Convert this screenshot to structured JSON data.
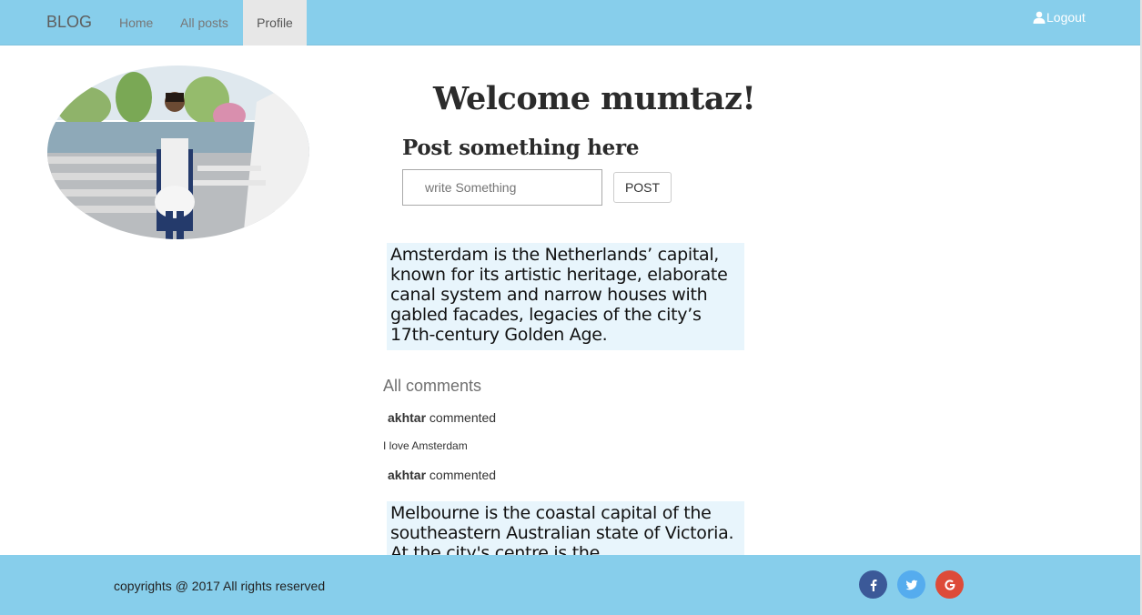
{
  "navbar": {
    "brand": "BLOG",
    "items": [
      {
        "label": "Home"
      },
      {
        "label": "All posts"
      },
      {
        "label": "Profile",
        "active": true
      }
    ],
    "logout_label": "Logout",
    "logout_icon": "user-icon",
    "bg_color": "#87CEEB"
  },
  "main": {
    "welcome": "Welcome mumtaz!",
    "post_heading": "Post something here",
    "post_input": {
      "placeholder": "write Something",
      "value": ""
    },
    "post_button": "POST",
    "posts": [
      {
        "text": "Amsterdam is the Netherlands’ capital, known for its artistic heritage, elaborate canal system and narrow houses with gabled facades, legacies of the city’s 17th-century Golden Age."
      },
      {
        "text": "Melbourne is the coastal capital of the southeastern Australian state of Victoria. At the city's centre is the"
      }
    ],
    "comments_title": "All comments",
    "comments": [
      {
        "author": "akhtar",
        "action": "commented",
        "text": "I love Amsterdam"
      },
      {
        "author": "akhtar",
        "action": "commented"
      }
    ]
  },
  "footer": {
    "copyright": "copyrights @ 2017 All rights reserved",
    "social": [
      {
        "icon": "facebook-icon",
        "color": "#3b5998"
      },
      {
        "icon": "twitter-icon",
        "color": "#55acee"
      },
      {
        "icon": "google-plus-icon",
        "color": "#dd4b39"
      }
    ]
  }
}
